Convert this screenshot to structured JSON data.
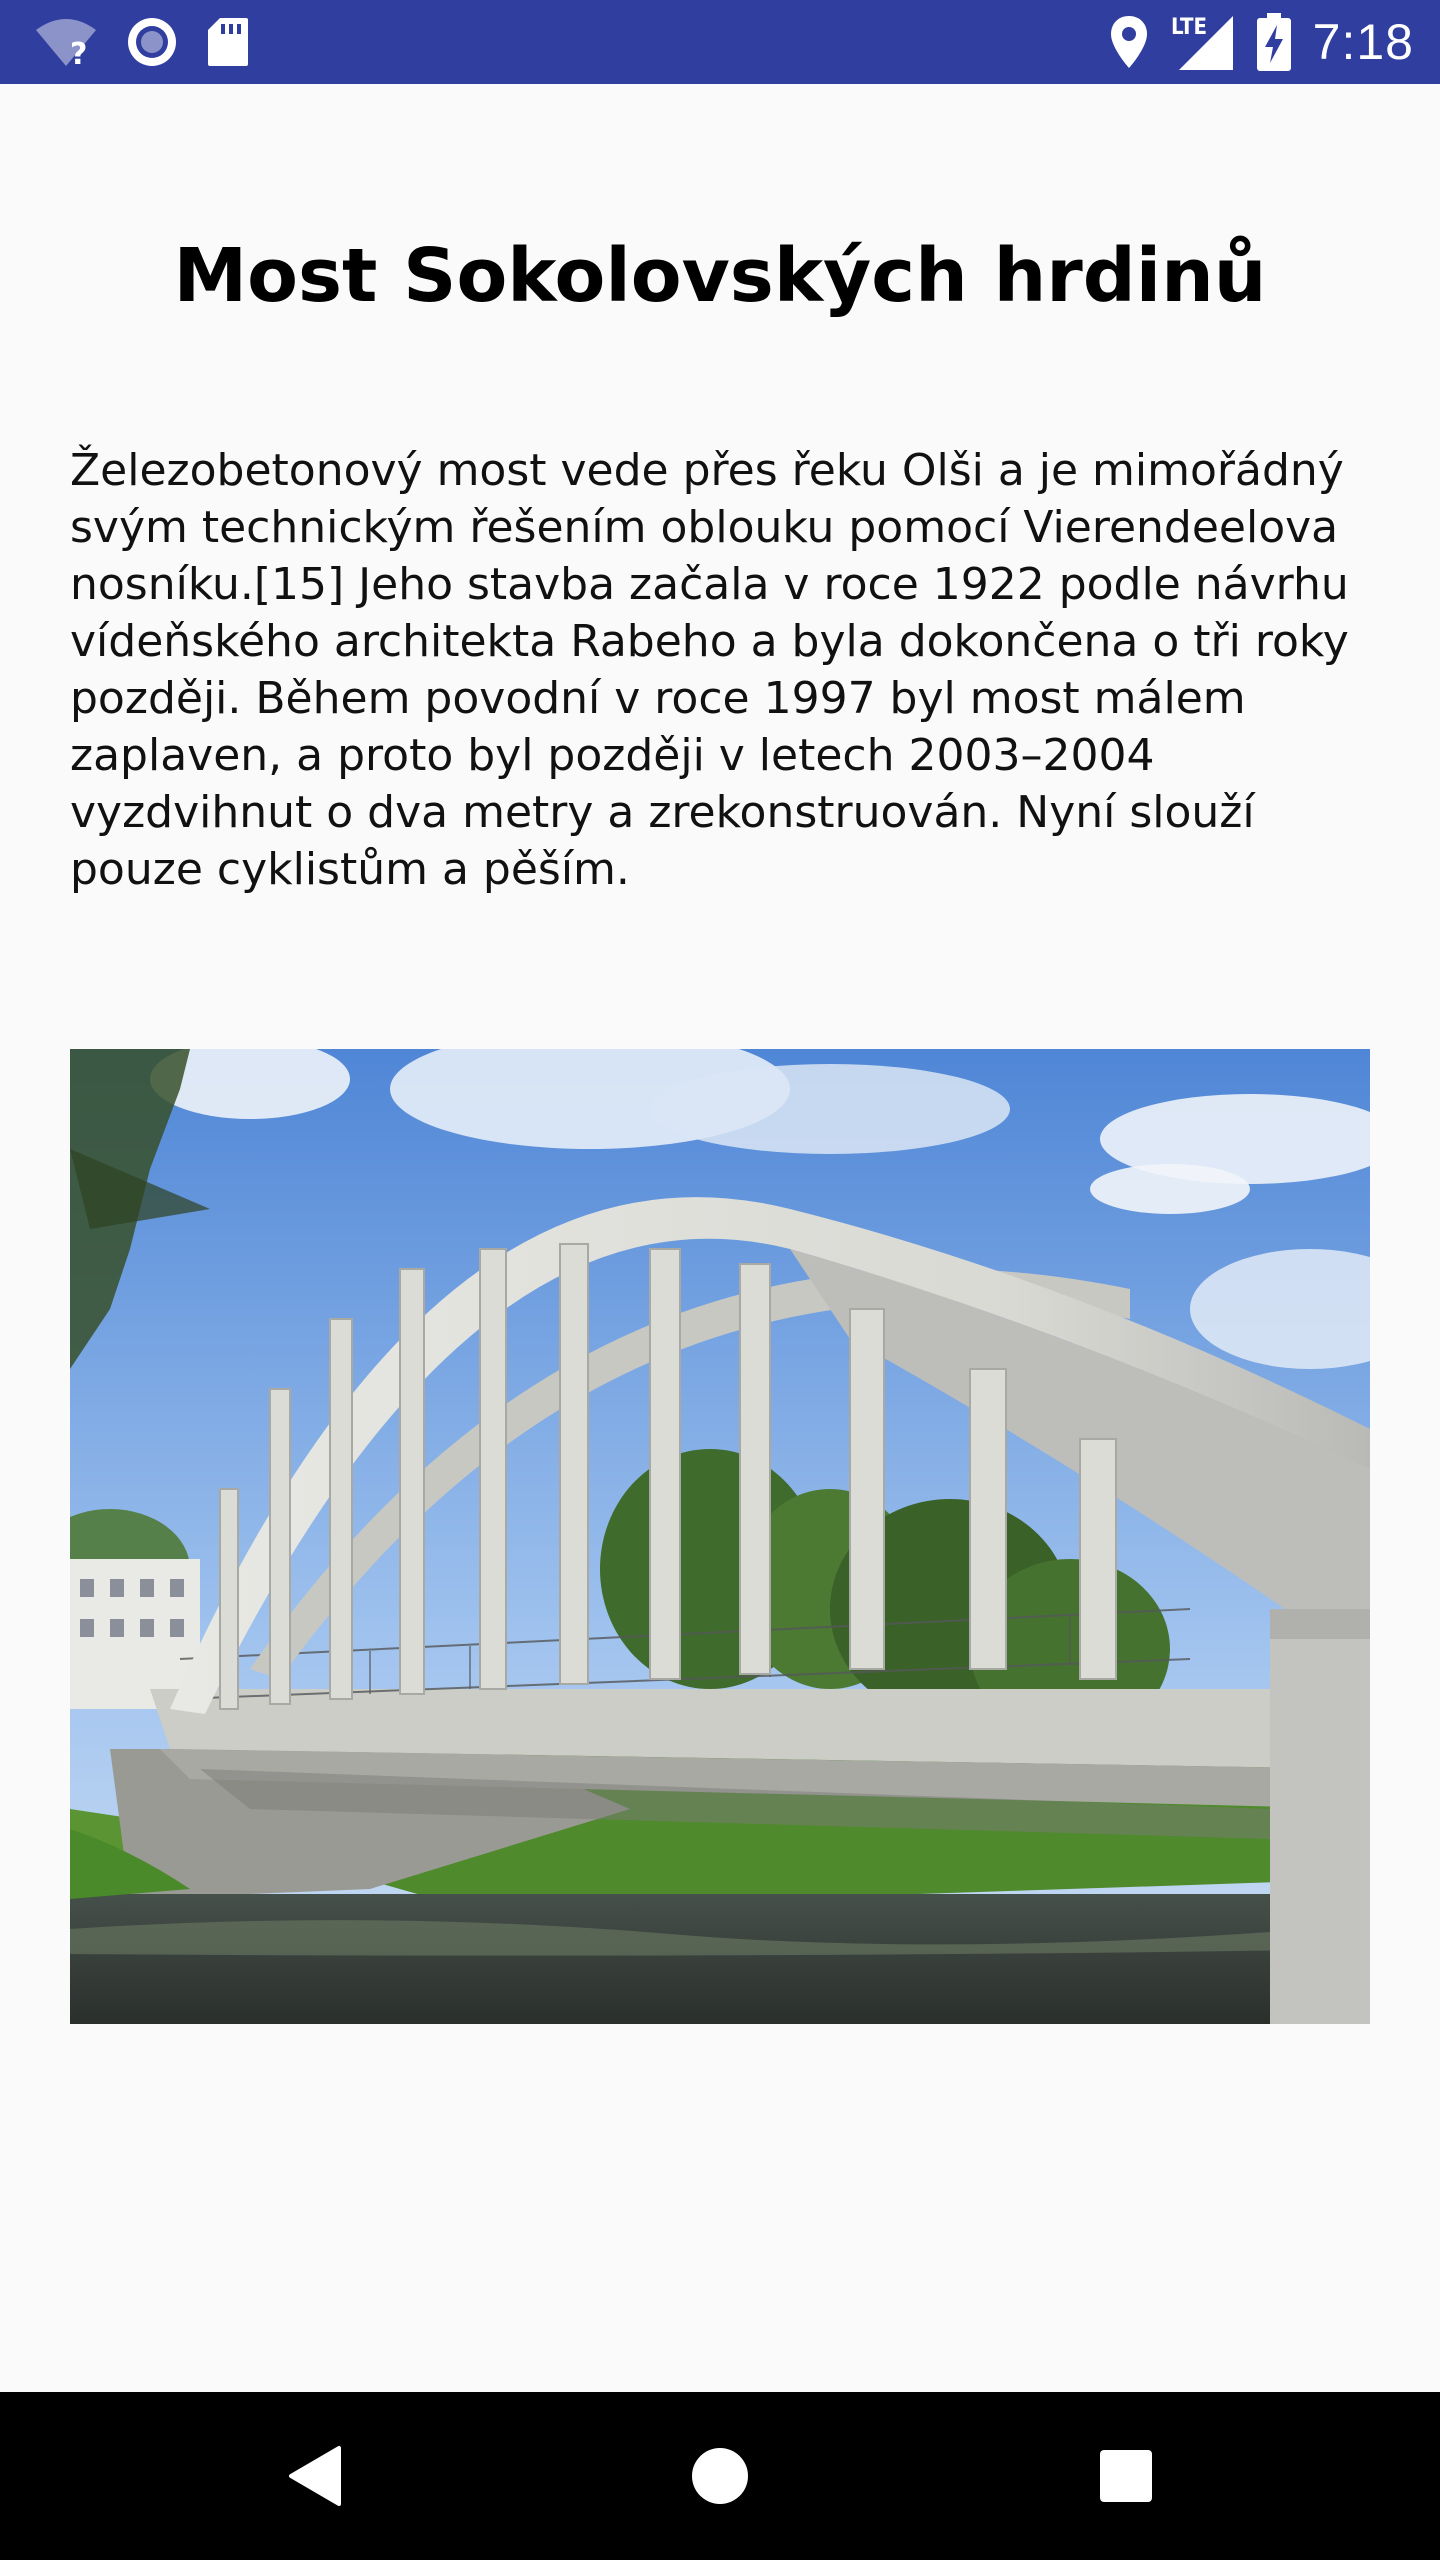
{
  "status_bar": {
    "time": "7:18",
    "network_label": "LTE",
    "wifi_unknown_mark": "?",
    "icons": [
      "wifi-unknown-icon",
      "sync-circle-icon",
      "sd-card-icon",
      "location-icon",
      "lte-signal-icon",
      "battery-charging-icon"
    ],
    "background_color": "#303f9f"
  },
  "article": {
    "title": "Most Sokolovských hrdinů",
    "description": "Železobetonový most vede přes řeku Olši a je mimořádný svým technickým řešením oblouku pomocí Vierendeelova nosníku.[15] Jeho stavba začala v roce 1922 podle návrhu vídeňského architekta Rabeho a byla dokončena o tři roky později. Během povodní v roce 1997 byl most málem zaplaven, a proto byl později v letech 2003–2004 vyzdvihnut o dva metry a zrekonstruován. Nyní slouží pouze cyklistům a pěším.",
    "image_icon": "bridge-photo"
  },
  "nav_bar": {
    "icons": [
      "back-icon",
      "home-icon",
      "recents-icon"
    ]
  }
}
